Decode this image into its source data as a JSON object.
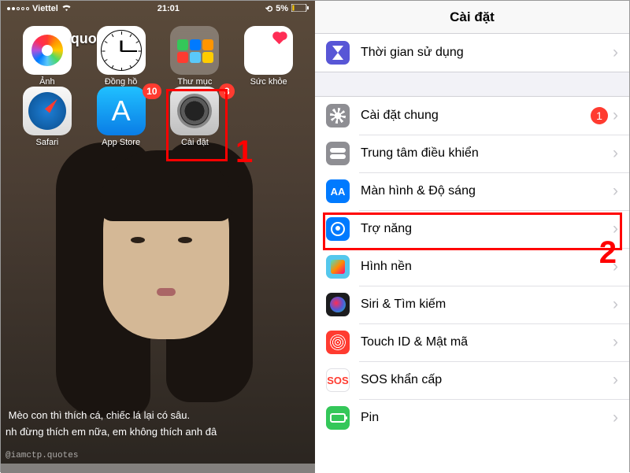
{
  "left": {
    "statusbar": {
      "carrier": "Viettel",
      "time": "21:01",
      "battery": "5%"
    },
    "overlay_text": "quo",
    "apps_row1": [
      {
        "label": "Ảnh"
      },
      {
        "label": "Đồng hồ"
      },
      {
        "label": "Thư mục"
      },
      {
        "label": "Sức khỏe"
      }
    ],
    "apps_row2": [
      {
        "label": "Safari"
      },
      {
        "label": "App Store",
        "badge": "10"
      },
      {
        "label": "Cài đặt",
        "badge": "3"
      }
    ],
    "annot1": "1",
    "caption_line1": " Mèo con thì thích cá, chiếc lá lại có sâu.",
    "caption_line2": "nh đừng thích em nữa, em không thích anh đâ",
    "watermark": "@iamctp.quotes"
  },
  "right": {
    "title": "Cài đặt",
    "screen_time": {
      "label": "Thời gian sử dụng"
    },
    "rows": [
      {
        "label": "Cài đặt chung",
        "badge": "1"
      },
      {
        "label": "Trung tâm điều khiển"
      },
      {
        "label": "Màn hình & Độ sáng"
      },
      {
        "label": "Trợ năng"
      },
      {
        "label": "Hình nền"
      },
      {
        "label": "Siri & Tìm kiếm"
      },
      {
        "label": "Touch ID & Mật mã"
      },
      {
        "label": "SOS khẩn cấp"
      },
      {
        "label": "Pin"
      }
    ],
    "annot2": "2",
    "disp_AA": "AA",
    "sos_txt": "SOS"
  }
}
